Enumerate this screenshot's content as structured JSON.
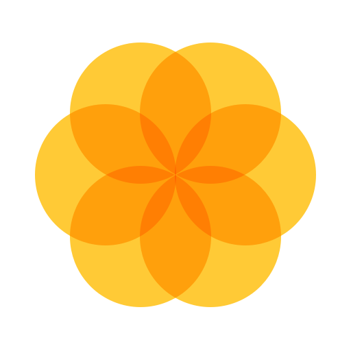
{
  "logo": {
    "icon": "flower-of-life-icon",
    "petal_count": 6,
    "colors": {
      "background": "#ffffff",
      "petal": "#ffbe0a",
      "petal_opacity": 0.82
    }
  }
}
